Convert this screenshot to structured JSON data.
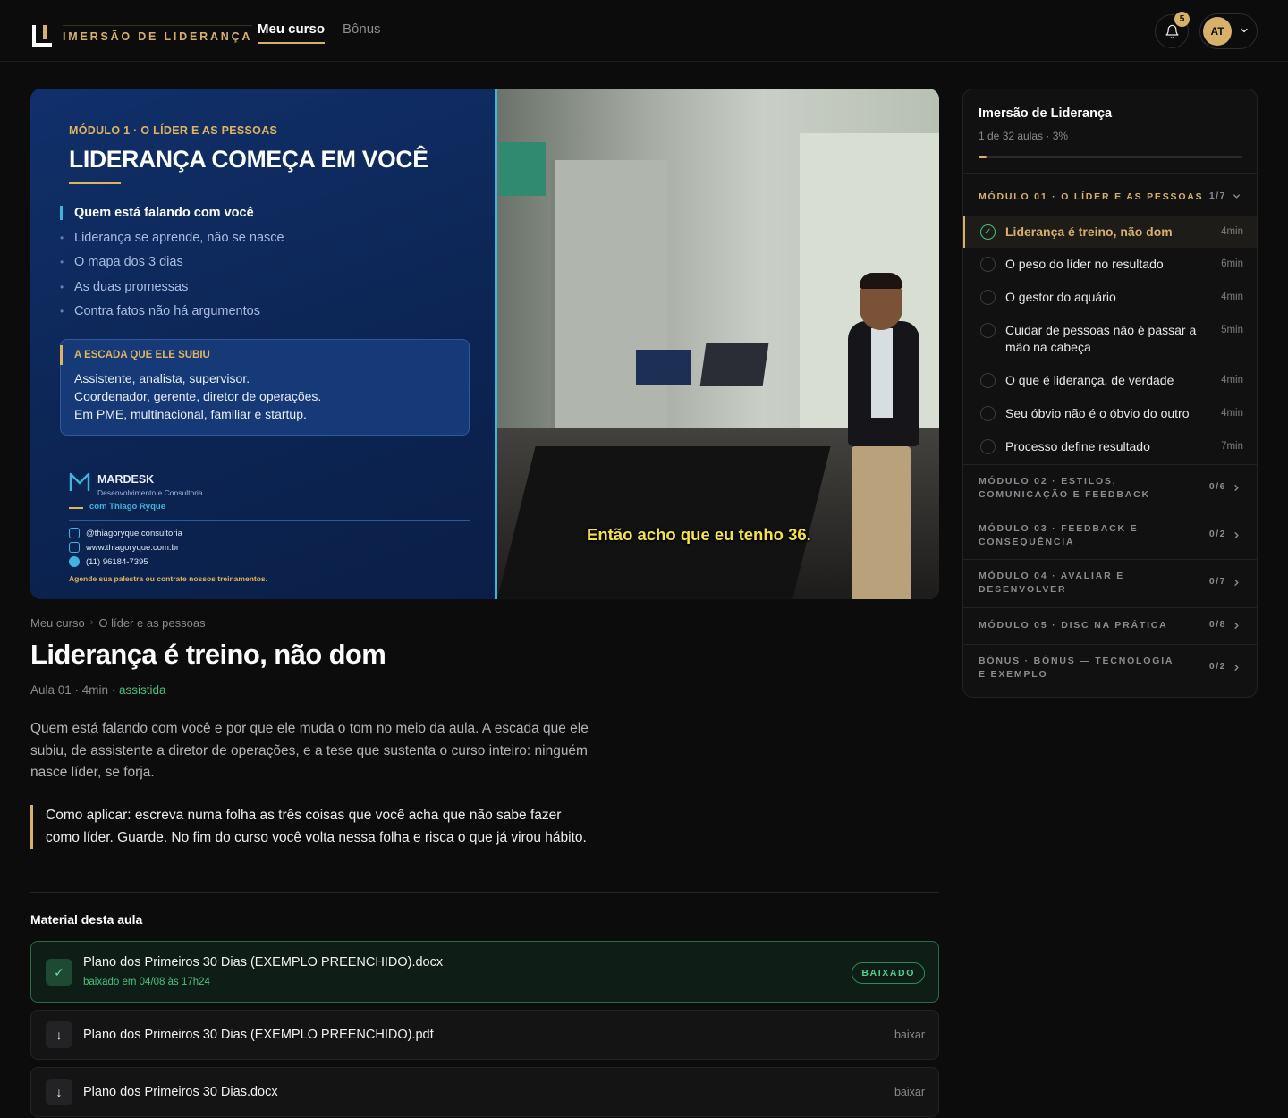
{
  "header": {
    "logo_text": "IMERSÃO DE LIDERANÇA",
    "tabs": [
      {
        "label": "Meu curso",
        "active": true
      },
      {
        "label": "Bônus",
        "active": false
      }
    ],
    "notifications_count": "5",
    "user_initials": "AT"
  },
  "video": {
    "slide": {
      "module": "MÓDULO 1 · O LÍDER E AS PESSOAS",
      "title": "LIDERANÇA COMEÇA EM VOCÊ",
      "bullets": [
        "Quem está falando com você",
        "Liderança se aprende, não se nasce",
        "O mapa dos 3 dias",
        "As duas promessas",
        "Contra fatos não há argumentos"
      ],
      "box_title": "A ESCADA QUE ELE SUBIU",
      "box_lines": [
        "Assistente, analista, supervisor.",
        "Coordenador, gerente, diretor de operações.",
        "Em PME, multinacional, familiar e startup."
      ],
      "brand_name": "MARDESK",
      "brand_sub": "Desenvolvimento e Consultoria",
      "brand_with": "com Thiago Ryque",
      "contacts": [
        "@thiagoryque.consultoria",
        "www.thiagoryque.com.br",
        "(11) 96184-7395"
      ],
      "cta": "Agende sua palestra ou contrate nossos treinamentos."
    },
    "subtitle": "Então acho que eu tenho 36."
  },
  "lesson": {
    "breadcrumb": [
      "Meu curso",
      "O líder e as pessoas"
    ],
    "title": "Liderança é treino, não dom",
    "meta": "Aula 01 · 4min · ",
    "status": "assistida",
    "description": "Quem está falando com você e por que ele muda o tom no meio da aula. A escada que ele subiu, de assistente a diretor de operações, e a tese que sustenta o curso inteiro: ninguém nasce líder, se forja.",
    "tip": "Como aplicar: escreva numa folha as três coisas que você acha que não sabe fazer como líder. Guarde. No fim do curso você volta nessa folha e risca o que já virou hábito."
  },
  "materials": {
    "title": "Material desta aula",
    "items": [
      {
        "name": "Plano dos Primeiros 30 Dias (EXEMPLO PREENCHIDO).docx",
        "sub": "baixado em 04/08 às 17h24",
        "badge": "BAIXADO"
      },
      {
        "name": "Plano dos Primeiros 30 Dias (EXEMPLO PREENCHIDO).pdf",
        "action": "baixar"
      },
      {
        "name": "Plano dos Primeiros 30 Dias.docx",
        "action": "baixar"
      }
    ]
  },
  "sidebar": {
    "course_title": "Imersão de Liderança",
    "progress_text": "1 de 32 aulas · 3%",
    "progress": 0.03,
    "open_module": {
      "title": "MÓDULO 01 · O LÍDER E AS PESSOAS",
      "count": "1/7",
      "lessons": [
        {
          "title": "Liderança é treino, não dom",
          "duration": "4min",
          "done": true,
          "active": true
        },
        {
          "title": "O peso do líder no resultado",
          "duration": "6min"
        },
        {
          "title": "O gestor do aquário",
          "duration": "4min"
        },
        {
          "title": "Cuidar de pessoas não é passar a mão na cabeça",
          "duration": "5min"
        },
        {
          "title": "O que é liderança, de verdade",
          "duration": "4min"
        },
        {
          "title": "Seu óbvio não é o óbvio do outro",
          "duration": "4min"
        },
        {
          "title": "Processo define resultado",
          "duration": "7min"
        }
      ]
    },
    "modules": [
      {
        "title": "MÓDULO 02 · ESTILOS, COMUNICAÇÃO E FEEDBACK",
        "count": "0/6"
      },
      {
        "title": "MÓDULO 03 · FEEDBACK E CONSEQUÊNCIA",
        "count": "0/2"
      },
      {
        "title": "MÓDULO 04 · AVALIAR E DESENVOLVER",
        "count": "0/7"
      },
      {
        "title": "MÓDULO 05 · DISC NA PRÁTICA",
        "count": "0/8"
      },
      {
        "title": "BÔNUS · BÔNUS — TECNOLOGIA E EXEMPLO",
        "count": "0/2"
      }
    ]
  }
}
